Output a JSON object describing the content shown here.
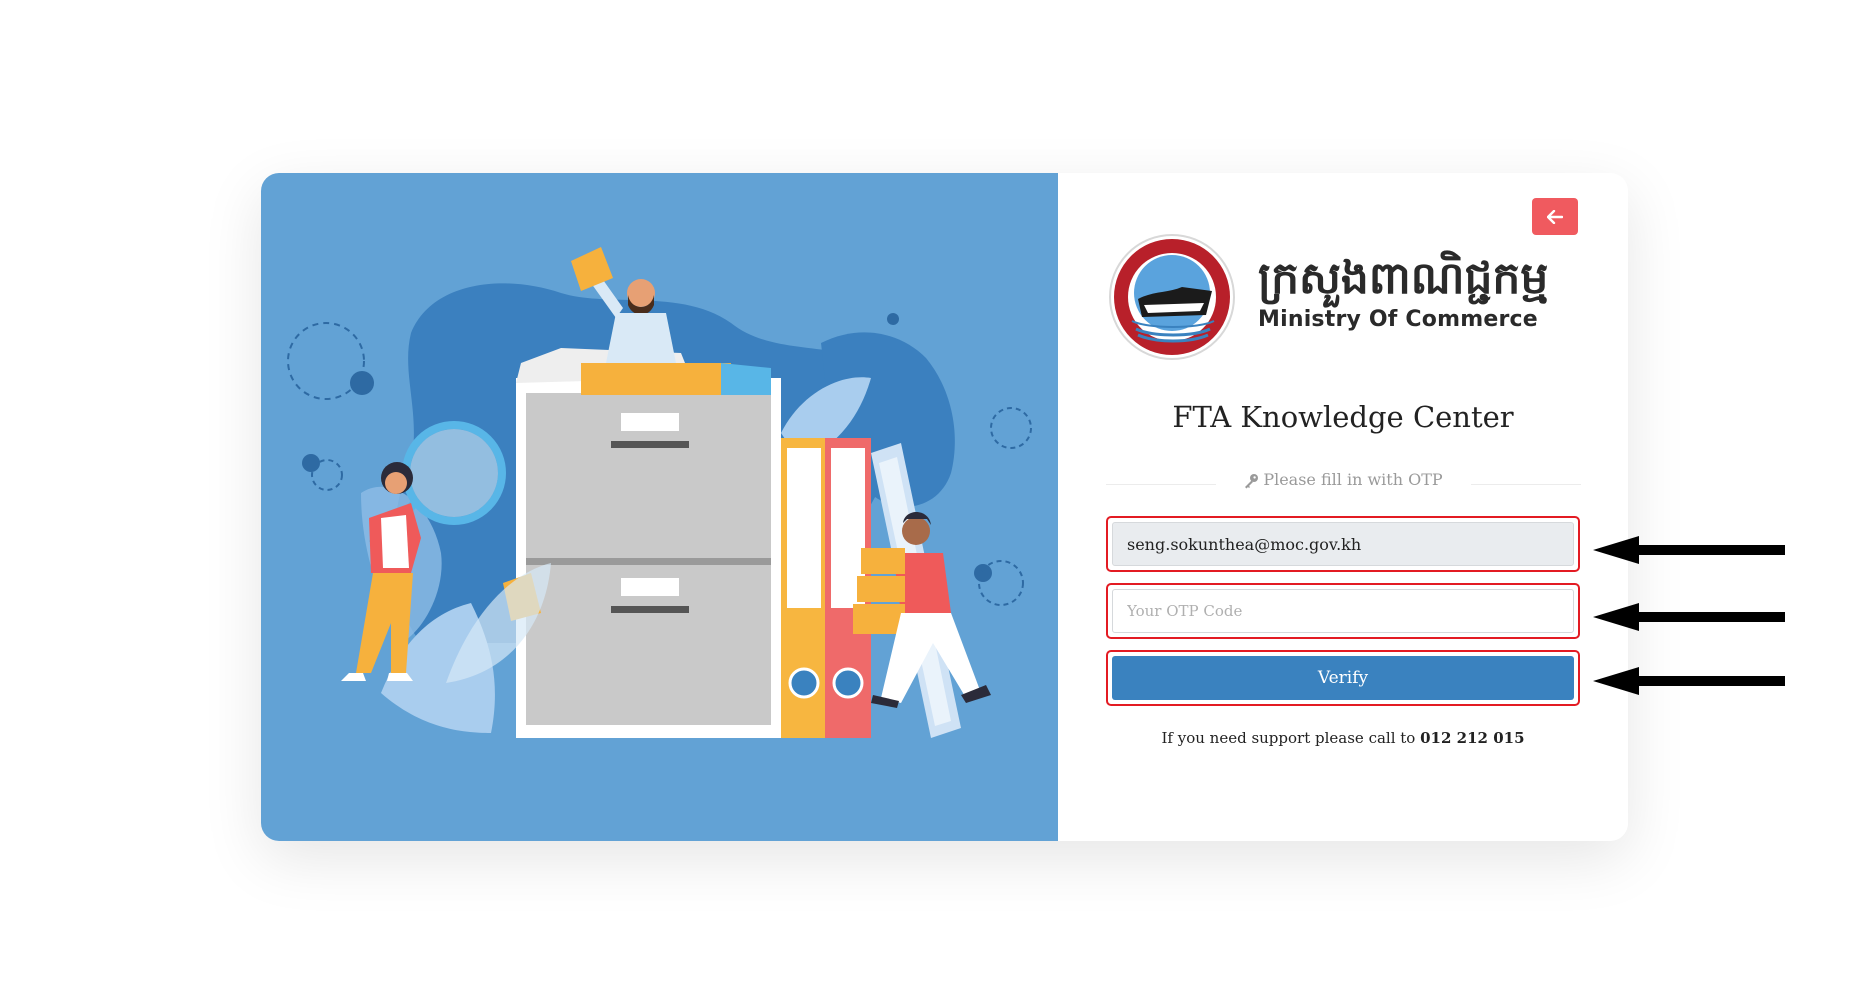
{
  "header": {
    "back_button_icon": "arrow-left-icon",
    "back_button_color": "#f05a5f"
  },
  "brand": {
    "khmer_name": "ក្រសួងពាណិជ្ជកម្ម",
    "english_name": "Ministry Of Commerce",
    "seal_text": "MINISTRY OF COMMERCE"
  },
  "page": {
    "title": "FTA Knowledge Center",
    "hint": "Please fill in with OTP",
    "hint_icon": "key-icon"
  },
  "form": {
    "email_value": "seng.sokunthea@moc.gov.kh",
    "otp_placeholder": "Your OTP Code",
    "otp_value": "",
    "verify_label": "Verify"
  },
  "support": {
    "text": "If you need support please call to",
    "phone": "012 212 015"
  },
  "colors": {
    "left_panel": "#62a2d5",
    "primary": "#3a82bf",
    "highlight": "#e31b23"
  },
  "annotations": {
    "arrow_icon": "arrow-left-icon",
    "highlight_count": 3
  }
}
